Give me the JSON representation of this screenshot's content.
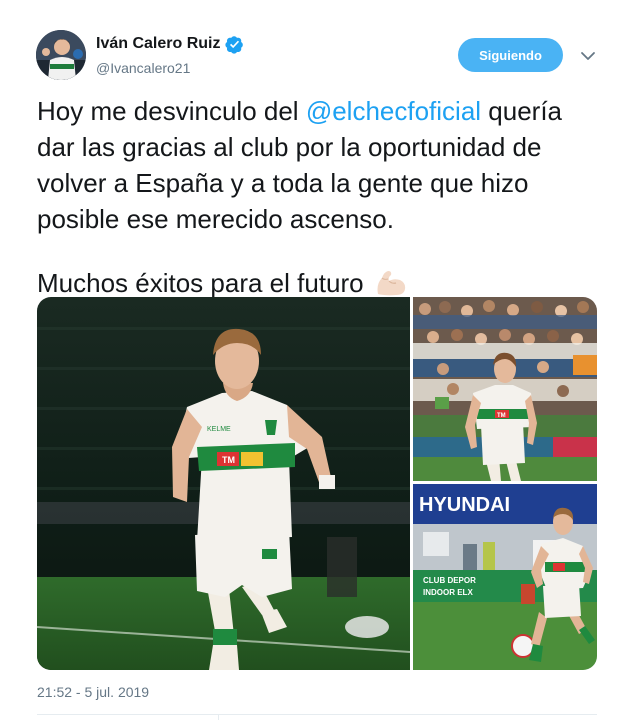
{
  "author": {
    "name": "Iván Calero Ruiz",
    "handle": "@Ivancalero21",
    "verified": true
  },
  "follow_button": {
    "label": "Siguiendo"
  },
  "tweet": {
    "line1_before": "Hoy me desvinculo del ",
    "mention": "@elchecfoficial",
    "line1_after": " quería dar las gracias al club por la oportunidad de volver a España y a toda la gente que hizo posible ese merecido ascenso.",
    "line2": "Muchos éxitos para el futuro",
    "emoji": "flexed-biceps-icon"
  },
  "media": {
    "photo_count": 3,
    "photo_main_texts": [
      "KELME",
      "TM"
    ],
    "photo_top_texts": [
      "TM"
    ],
    "photo_bottom_texts": [
      "HYUNDAI",
      "CLUB DEPOR",
      "INDOOR ELX"
    ]
  },
  "timestamp": "21:52 - 5 jul. 2019",
  "colors": {
    "accent": "#1da1f2",
    "button": "#4ab3f4",
    "secondary_text": "#657786",
    "divider": "#e6ecf0"
  }
}
